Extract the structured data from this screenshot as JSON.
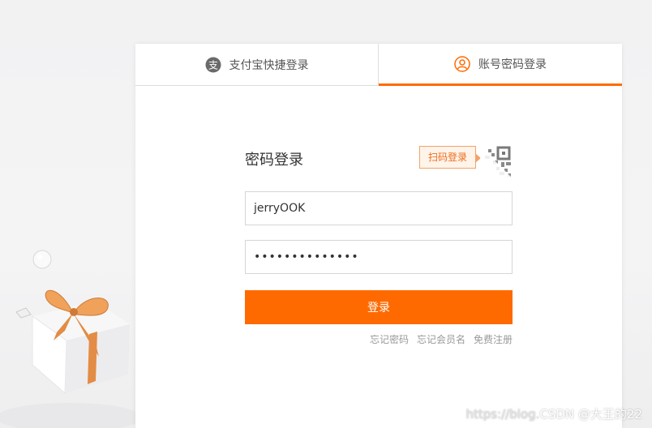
{
  "tabs": {
    "alipay_label": "支付宝快捷登录",
    "account_label": "账号密码登录"
  },
  "form": {
    "title": "密码登录",
    "qr_tip": "扫码登录",
    "username_value": "jerryOOK",
    "password_masked": "••••••••••••••",
    "submit_label": "登录"
  },
  "links": {
    "forgot_password": "忘记密码",
    "forgot_username": "忘记会员名",
    "register": "免费注册"
  },
  "watermark": {
    "url": "https://blog.",
    "text": "CSDN @大王的22"
  },
  "colors": {
    "accent": "#ff6a00",
    "tip_bg": "#fef4ea",
    "tip_border": "#f3a368"
  },
  "icons": [
    "alipay-icon",
    "user-circle-icon",
    "qr-code-icon",
    "gift-decoration"
  ]
}
